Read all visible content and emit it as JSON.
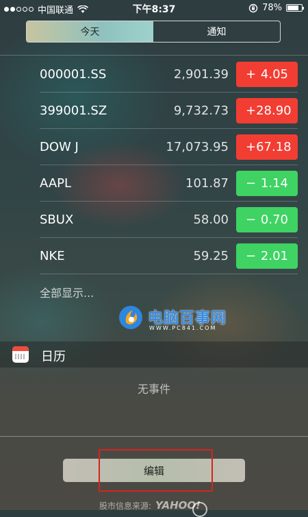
{
  "status_bar": {
    "carrier": "中国联通",
    "time": "下午8:37",
    "battery": "78%",
    "battery_level": 0.78,
    "signal_bars_filled": 2,
    "signal_bars_total": 5
  },
  "tabs": [
    {
      "label": "今天",
      "active": true
    },
    {
      "label": "通知",
      "active": false
    }
  ],
  "stocks": [
    {
      "symbol": "000001.SS",
      "price": "2,901.39",
      "sign": "+",
      "change": "4.05",
      "direction": "up"
    },
    {
      "symbol": "399001.SZ",
      "price": "9,732.73",
      "sign": "+",
      "change": "28.90",
      "direction": "up"
    },
    {
      "symbol": "DOW J",
      "price": "17,073.95",
      "sign": "+",
      "change": "67.18",
      "direction": "up"
    },
    {
      "symbol": "AAPL",
      "price": "101.87",
      "sign": "−",
      "change": "1.14",
      "direction": "down"
    },
    {
      "symbol": "SBUX",
      "price": "58.00",
      "sign": "−",
      "change": "0.70",
      "direction": "down"
    },
    {
      "symbol": "NKE",
      "price": "59.25",
      "sign": "−",
      "change": "2.01",
      "direction": "down"
    }
  ],
  "show_all_label": "全部显示...",
  "watermark": {
    "title": "电脑百事网",
    "subtitle": "WWW.PC841.COM"
  },
  "calendar": {
    "title": "日历",
    "empty_text": "无事件"
  },
  "edit_label": "编辑",
  "footer": {
    "source_label": "股市信息来源:",
    "provider": "YAHOO!"
  },
  "colors": {
    "up": "#f23d33",
    "down": "#3ed362",
    "highlight": "#d8221e",
    "watermark": "#3a8ce0"
  }
}
